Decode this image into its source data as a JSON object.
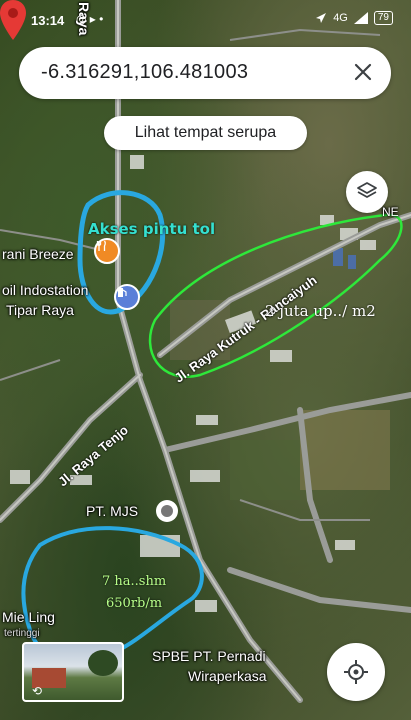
{
  "status_bar": {
    "time": "13:14",
    "left_icons": "◎ ▸ •",
    "signal_text": "4G",
    "battery": "79"
  },
  "search": {
    "query": "-6.316291,106.481003"
  },
  "chip": {
    "label": "Lihat tempat serupa"
  },
  "map_labels": {
    "top_road": "Raya",
    "aksi_annotation": "Akses pintu tol",
    "poi_breeze": "rani Breeze",
    "poi_indostation": "oil Indostation",
    "poi_tipar": "Tipar Raya",
    "road_kutruk": "Jl. Raya Kutruk - Rancaiyuh",
    "road_tenjo": "Jl. Raya Tenjo",
    "price_note": "2 juta up../ m2",
    "poi_mjs": "PT. MJS",
    "land_size": "7 ha..shm",
    "land_price": "650rb/m",
    "poi_mie": "Mie Ling",
    "poi_mie_sub": "tertinggi",
    "poi_spbe_line1": "SPBE PT. Pernadi",
    "poi_spbe_line2": "Wiraperkasa",
    "edge_label": "NE"
  },
  "colors": {
    "annotation_blue": "#29a8e0",
    "annotation_green": "#2ee83a",
    "annotation_cyan_text": "#35e0d0",
    "pin_red": "#e53935",
    "food_orange": "#f08a24",
    "gas_blue": "#5a7fd8"
  },
  "icons": {
    "close": "close-icon",
    "layers": "layers-icon",
    "locate": "my-location-icon"
  }
}
